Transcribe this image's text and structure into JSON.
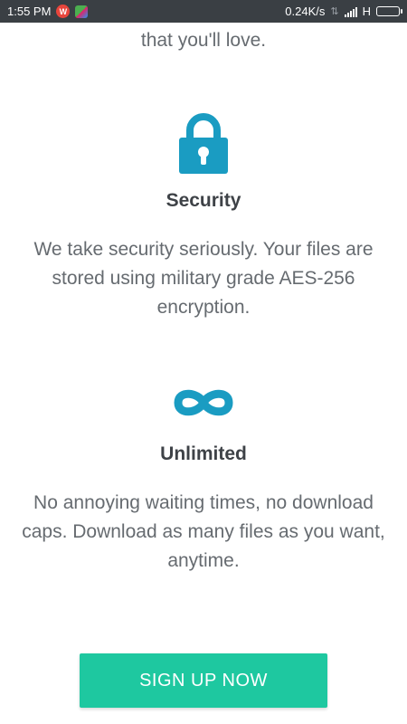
{
  "status_bar": {
    "time": "1:55 PM",
    "app_badge_w": "W",
    "speed": "0.24K/s",
    "network_type": "H"
  },
  "intro": {
    "tail_text": "that you'll love."
  },
  "features": [
    {
      "icon": "lock-icon",
      "title": "Security",
      "description": "We take security seriously. Your files are stored using military grade AES-256 encryption."
    },
    {
      "icon": "infinity-icon",
      "title": "Unlimited",
      "description": "No annoying waiting times, no download caps. Download as many files as you want, anytime."
    }
  ],
  "cta": {
    "signup_label": "SIGN UP NOW"
  },
  "colors": {
    "accent": "#1ec8a0",
    "icon_blue": "#1a9cc2",
    "title_text": "#3e4247",
    "body_text": "#666b70",
    "status_bar": "#3a3f44"
  }
}
